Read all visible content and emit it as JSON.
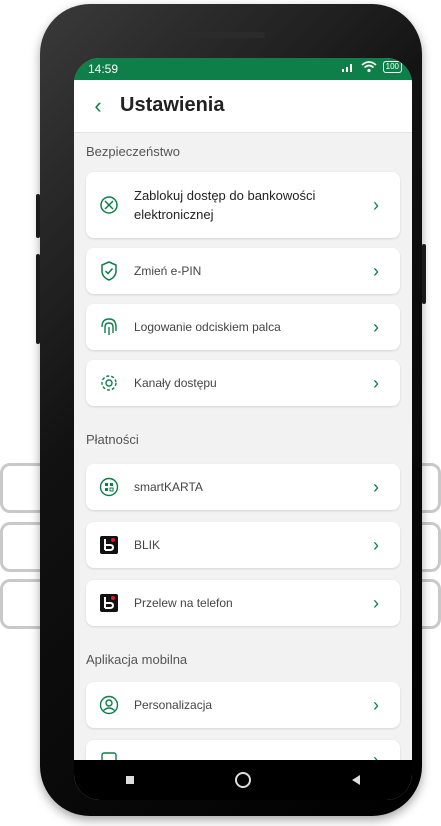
{
  "status_bar": {
    "time": "14:59",
    "battery": "100"
  },
  "header": {
    "title": "Ustawienia"
  },
  "sections": [
    {
      "title": "Bezpieczeństwo",
      "items": [
        {
          "label": "Zablokuj dostęp do bankowości elektronicznej",
          "icon": "block-icon"
        },
        {
          "label": "Zmień e-PIN",
          "icon": "shield-check-icon"
        },
        {
          "label": "Logowanie odciskiem palca",
          "icon": "fingerprint-icon"
        },
        {
          "label": "Kanały dostępu",
          "icon": "gear-icon"
        }
      ]
    },
    {
      "title": "Płatności",
      "items": [
        {
          "label": "smartKARTA",
          "icon": "smartkarta-icon"
        },
        {
          "label": "BLIK",
          "icon": "blik-icon"
        },
        {
          "label": "Przelew na telefon",
          "icon": "blik-icon"
        }
      ]
    },
    {
      "title": "Aplikacja mobilna",
      "items": [
        {
          "label": "Personalizacja",
          "icon": "user-circle-icon"
        }
      ]
    }
  ],
  "colors": {
    "accent": "#0e7f49",
    "background": "#f1f2f1"
  }
}
